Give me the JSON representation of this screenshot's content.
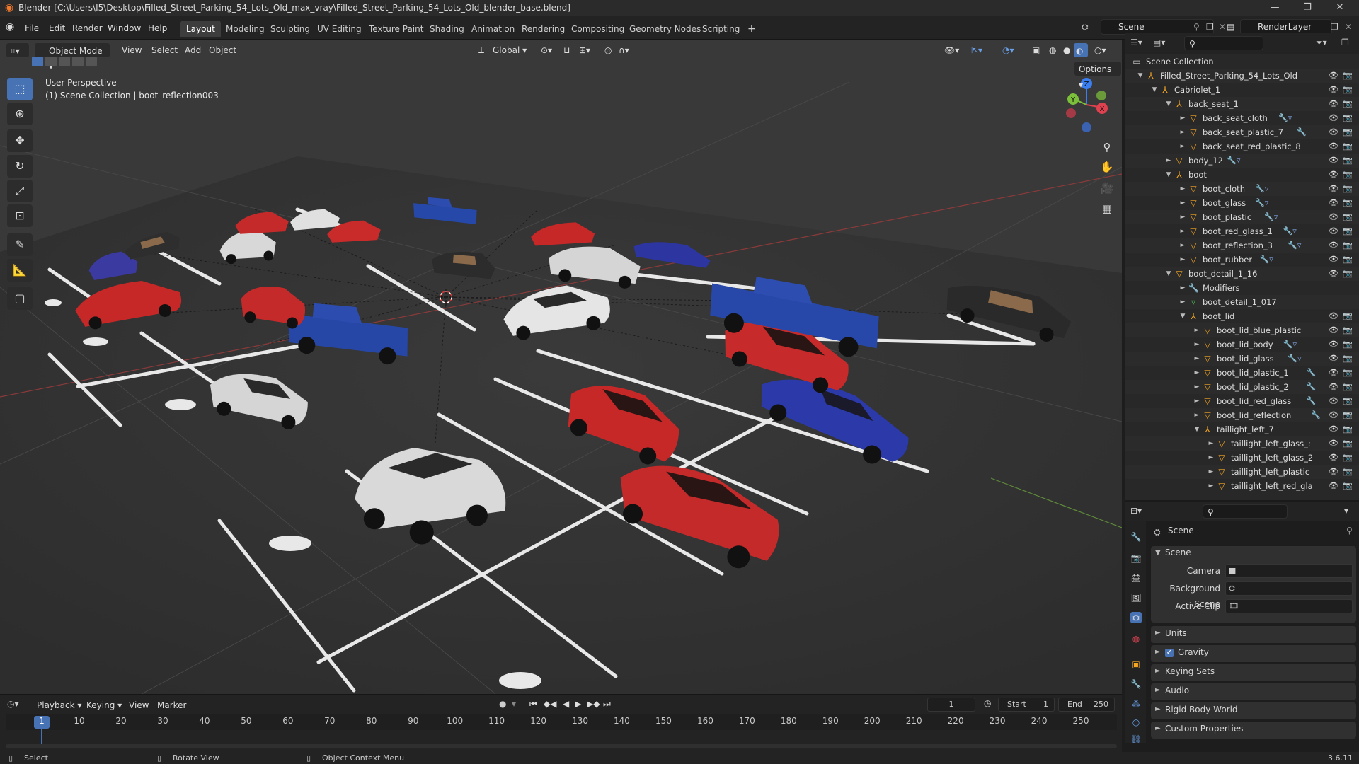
{
  "title": "Blender [C:\\Users\\I5\\Desktop\\Filled_Street_Parking_54_Lots_Old_max_vray\\Filled_Street_Parking_54_Lots_Old_blender_base.blend]",
  "menu": [
    "File",
    "Edit",
    "Render",
    "Window",
    "Help"
  ],
  "workspaces": [
    "Layout",
    "Modeling",
    "Sculpting",
    "UV Editing",
    "Texture Paint",
    "Shading",
    "Animation",
    "Rendering",
    "Compositing",
    "Geometry Nodes",
    "Scripting"
  ],
  "scene_name": "Scene",
  "render_layer": "RenderLayer",
  "viewport": {
    "mode": "Object Mode",
    "menus": [
      "View",
      "Select",
      "Add",
      "Object"
    ],
    "transform_orientation": "Global",
    "options_label": "Options",
    "perspective": "User Perspective",
    "collection_info": "(1) Scene Collection | boot_reflection003",
    "axes": [
      "X",
      "Y",
      "Z"
    ]
  },
  "outliner": {
    "rows": [
      {
        "label": "Scene Collection",
        "depth": 0,
        "icon": "collection-icon",
        "color": "#cfcfcf",
        "tri": ""
      },
      {
        "label": "Filled_Street_Parking_54_Lots_Old",
        "depth": 1,
        "icon": "empty-icon",
        "color": "#f5a623",
        "tri": "▼"
      },
      {
        "label": "Cabriolet_1",
        "depth": 2,
        "icon": "empty-icon",
        "color": "#f5a623",
        "tri": "▼"
      },
      {
        "label": "back_seat_1",
        "depth": 3,
        "icon": "empty-icon",
        "color": "#f5a623",
        "tri": "▼"
      },
      {
        "label": "back_seat_cloth",
        "depth": 4,
        "icon": "mesh-icon",
        "color": "#f5a623",
        "tri": "►",
        "mods": 2
      },
      {
        "label": "back_seat_plastic_7",
        "depth": 4,
        "icon": "mesh-icon",
        "color": "#f5a623",
        "tri": "►",
        "mods": 1
      },
      {
        "label": "back_seat_red_plastic_8",
        "depth": 4,
        "icon": "mesh-icon",
        "color": "#f5a623",
        "tri": "►",
        "mods": 0
      },
      {
        "label": "body_12",
        "depth": 3,
        "icon": "mesh-icon",
        "color": "#f5a623",
        "tri": "►",
        "mods": 2
      },
      {
        "label": "boot",
        "depth": 3,
        "icon": "empty-icon",
        "color": "#f5a623",
        "tri": "▼"
      },
      {
        "label": "boot_cloth",
        "depth": 4,
        "icon": "mesh-icon",
        "color": "#f5a623",
        "tri": "►",
        "mods": 2
      },
      {
        "label": "boot_glass",
        "depth": 4,
        "icon": "mesh-icon",
        "color": "#f5a623",
        "tri": "►",
        "mods": 2
      },
      {
        "label": "boot_plastic",
        "depth": 4,
        "icon": "mesh-icon",
        "color": "#f5a623",
        "tri": "►",
        "mods": 2
      },
      {
        "label": "boot_red_glass_1",
        "depth": 4,
        "icon": "mesh-icon",
        "color": "#f5a623",
        "tri": "►",
        "mods": 2
      },
      {
        "label": "boot_reflection_3",
        "depth": 4,
        "icon": "mesh-icon",
        "color": "#f5a623",
        "tri": "►",
        "mods": 2
      },
      {
        "label": "boot_rubber",
        "depth": 4,
        "icon": "mesh-icon",
        "color": "#f5a623",
        "tri": "►",
        "mods": 2
      },
      {
        "label": "boot_detail_1_16",
        "depth": 3,
        "icon": "mesh-icon",
        "color": "#f5a623",
        "tri": "▼"
      },
      {
        "label": "Modifiers",
        "depth": 4,
        "icon": "wrench-icon",
        "color": "#7da3e0",
        "tri": "►"
      },
      {
        "label": "boot_detail_1_017",
        "depth": 4,
        "icon": "meshdata-icon",
        "color": "#4ec94e",
        "tri": "►"
      },
      {
        "label": "boot_lid",
        "depth": 4,
        "icon": "empty-icon",
        "color": "#f5a623",
        "tri": "▼"
      },
      {
        "label": "boot_lid_blue_plastic",
        "depth": 5,
        "icon": "mesh-icon",
        "color": "#f5a623",
        "tri": "►",
        "mods": 0
      },
      {
        "label": "boot_lid_body",
        "depth": 5,
        "icon": "mesh-icon",
        "color": "#f5a623",
        "tri": "►",
        "mods": 2
      },
      {
        "label": "boot_lid_glass",
        "depth": 5,
        "icon": "mesh-icon",
        "color": "#f5a623",
        "tri": "►",
        "mods": 2
      },
      {
        "label": "boot_lid_plastic_1",
        "depth": 5,
        "icon": "mesh-icon",
        "color": "#f5a623",
        "tri": "►",
        "mods": 1
      },
      {
        "label": "boot_lid_plastic_2",
        "depth": 5,
        "icon": "mesh-icon",
        "color": "#f5a623",
        "tri": "►",
        "mods": 1
      },
      {
        "label": "boot_lid_red_glass",
        "depth": 5,
        "icon": "mesh-icon",
        "color": "#f5a623",
        "tri": "►",
        "mods": 1
      },
      {
        "label": "boot_lid_reflection",
        "depth": 5,
        "icon": "mesh-icon",
        "color": "#f5a623",
        "tri": "►",
        "mods": 1
      },
      {
        "label": "taillight_left_7",
        "depth": 5,
        "icon": "empty-icon",
        "color": "#f5a623",
        "tri": "▼"
      },
      {
        "label": "taillight_left_glass_:",
        "depth": 6,
        "icon": "mesh-icon",
        "color": "#f5a623",
        "tri": "►"
      },
      {
        "label": "taillight_left_glass_2",
        "depth": 6,
        "icon": "mesh-icon",
        "color": "#f5a623",
        "tri": "►"
      },
      {
        "label": "taillight_left_plastic",
        "depth": 6,
        "icon": "mesh-icon",
        "color": "#f5a623",
        "tri": "►"
      },
      {
        "label": "taillight_left_red_gla",
        "depth": 6,
        "icon": "mesh-icon",
        "color": "#f5a623",
        "tri": "►"
      }
    ]
  },
  "properties": {
    "header": "Scene",
    "panel": "Scene",
    "fields": [
      {
        "label": "Camera",
        "value": ""
      },
      {
        "label": "Background Scene",
        "value": ""
      },
      {
        "label": "Active Clip",
        "value": ""
      }
    ],
    "sections": [
      "Units",
      "Gravity",
      "Keying Sets",
      "Audio",
      "Rigid Body World",
      "Custom Properties"
    ],
    "gravity_checked": true
  },
  "timeline": {
    "menus": [
      "Playback",
      "Keying",
      "View",
      "Marker"
    ],
    "current_frame": "1",
    "start_label": "Start",
    "start": "1",
    "end_label": "End",
    "end": "250",
    "ticks": [
      "1",
      "10",
      "20",
      "30",
      "40",
      "50",
      "60",
      "70",
      "80",
      "90",
      "100",
      "110",
      "120",
      "130",
      "140",
      "150",
      "160",
      "170",
      "180",
      "190",
      "200",
      "210",
      "220",
      "230",
      "240",
      "250"
    ]
  },
  "status": {
    "select": "Select",
    "rotate": "Rotate View",
    "context": "Object Context Menu",
    "version": "3.6.11"
  },
  "colors": {
    "accent": "#4772b3",
    "object": "#f5a623",
    "mesh_data": "#4ec94e",
    "axis_x": "#e0414f",
    "axis_y": "#7cbf3a",
    "axis_z": "#3b7ef0"
  }
}
